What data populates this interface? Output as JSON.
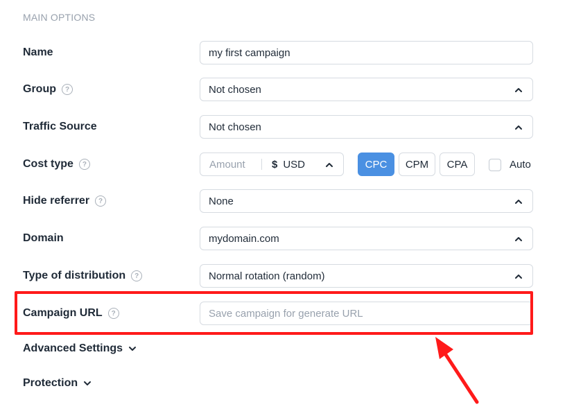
{
  "section_title": "MAIN OPTIONS",
  "fields": {
    "name": {
      "label": "Name",
      "value": "my first campaign"
    },
    "group": {
      "label": "Group",
      "value": "Not chosen"
    },
    "traffic_source": {
      "label": "Traffic Source",
      "value": "Not chosen"
    },
    "cost_type": {
      "label": "Cost type",
      "amount_placeholder": "Amount",
      "currency_symbol": "$",
      "currency": "USD",
      "options": [
        "CPC",
        "CPM",
        "CPA"
      ],
      "selected": "CPC",
      "auto_label": "Auto"
    },
    "hide_referrer": {
      "label": "Hide referrer",
      "value": "None"
    },
    "domain": {
      "label": "Domain",
      "value": "mydomain.com"
    },
    "distribution": {
      "label": "Type of distribution",
      "value": "Normal rotation (random)"
    },
    "campaign_url": {
      "label": "Campaign URL",
      "placeholder": "Save campaign for generate URL"
    }
  },
  "help_glyph": "?",
  "sections": {
    "advanced": "Advanced Settings",
    "protection": "Protection"
  },
  "colors": {
    "accent": "#4a90e2",
    "highlight": "#ff1a1a",
    "muted": "#98a1ad"
  }
}
